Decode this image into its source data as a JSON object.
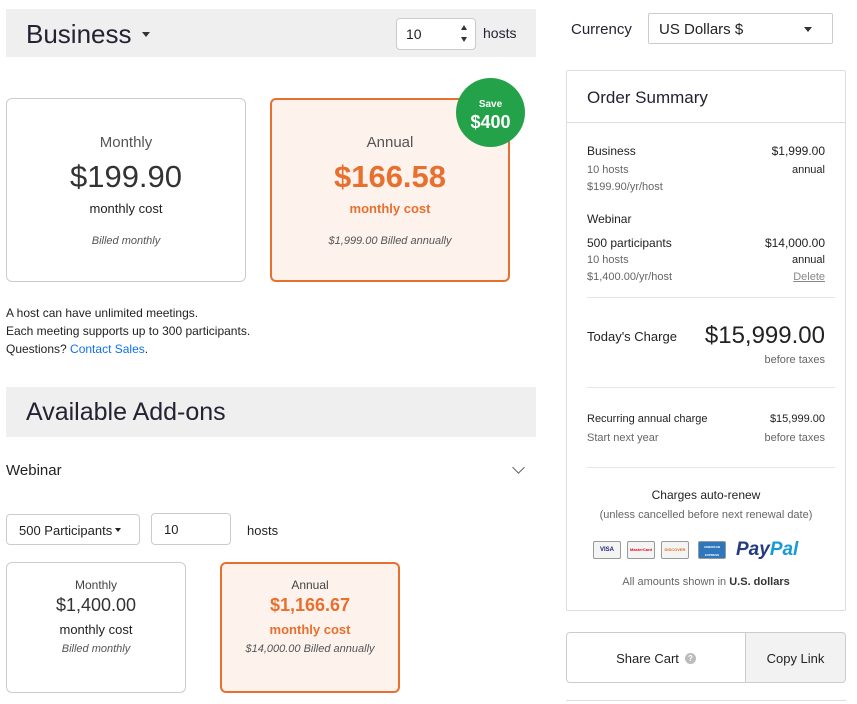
{
  "plan": {
    "name": "Business",
    "hosts_value": "10",
    "hosts_label": "hosts"
  },
  "pricing": {
    "monthly": {
      "period": "Monthly",
      "price": "$199.90",
      "cost_label": "monthly cost",
      "billed": "Billed monthly"
    },
    "annual": {
      "period": "Annual",
      "price": "$166.58",
      "cost_label": "monthly cost",
      "billed": "$1,999.00 Billed annually"
    },
    "save_badge": {
      "label": "Save",
      "amount": "$400"
    }
  },
  "info": {
    "line1": "A host can have unlimited meetings.",
    "line2": "Each meeting supports up to 300 participants.",
    "line3_prefix": "Questions? ",
    "contact_link": "Contact Sales",
    "line3_suffix": "."
  },
  "addons": {
    "title": "Available Add-ons",
    "webinar": {
      "label": "Webinar",
      "participants_selected": "500 Participants",
      "hosts_value": "10",
      "hosts_label": "hosts",
      "monthly": {
        "period": "Monthly",
        "price": "$1,400.00",
        "cost_label": "monthly cost",
        "billed": "Billed monthly"
      },
      "annual": {
        "period": "Annual",
        "price": "$1,166.67",
        "cost_label": "monthly cost",
        "billed": "$14,000.00 Billed annually"
      }
    }
  },
  "currency": {
    "label": "Currency",
    "selected": "US Dollars $"
  },
  "summary": {
    "title": "Order Summary",
    "business": {
      "name": "Business",
      "price": "$1,999.00",
      "hosts": "10 hosts",
      "period": "annual",
      "rate": "$199.90/yr/host"
    },
    "webinar": {
      "name": "Webinar",
      "participants": "500 participants",
      "price": "$14,000.00",
      "hosts": "10 hosts",
      "period": "annual",
      "rate": "$1,400.00/yr/host",
      "delete": "Delete"
    },
    "today": {
      "label": "Today's Charge",
      "amount": "$15,999.00",
      "note": "before taxes"
    },
    "recurring": {
      "label": "Recurring annual charge",
      "amount": "$15,999.00",
      "start": "Start next year",
      "note": "before taxes"
    },
    "renew": {
      "line1": "Charges auto-renew",
      "line2": "(unless cancelled before next renewal date)"
    },
    "cards": {
      "visa": "VISA",
      "mastercard": "MasterCard",
      "discover": "DISCOVER",
      "amex": "AMERICAN EXPRESS",
      "paypal_1": "Pay",
      "paypal_2": "Pal"
    },
    "amounts_note_prefix": "All amounts shown in ",
    "amounts_note_currency": "U.S. dollars"
  },
  "actions": {
    "share_cart": "Share Cart",
    "copy_link": "Copy Link"
  },
  "colors": {
    "accent_orange": "#e8702f",
    "annual_bg": "#fdf2ec",
    "save_green": "#24a24a",
    "link_blue": "#0e72ed",
    "header_gray": "#efefef"
  }
}
